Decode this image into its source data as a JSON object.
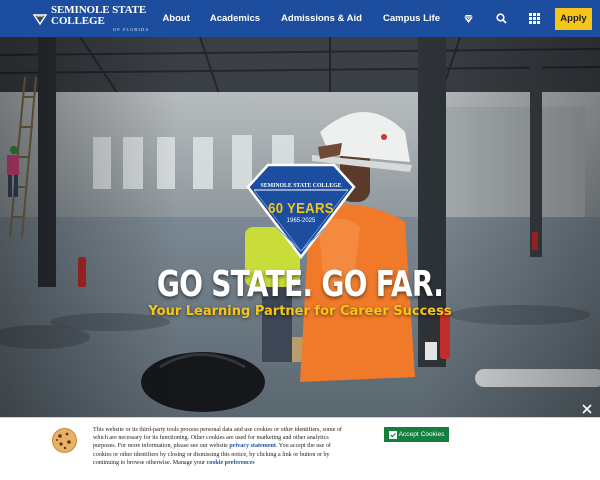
{
  "header": {
    "logo_name": "SEMINOLE STATE COLLEGE",
    "logo_sub": "OF FLORIDA",
    "nav": [
      "About",
      "Academics",
      "Admissions & Aid",
      "Campus Life"
    ],
    "icons": [
      "diamond-icon",
      "search-icon",
      "grid-menu-icon"
    ],
    "apply_label": "Apply",
    "colors": {
      "bar": "#1d4d9e",
      "apply": "#f5c518"
    }
  },
  "hero": {
    "badge_name": "SEMINOLE STATE COLLEGE",
    "badge_years": "60 YEARS",
    "badge_range": "1965-2025",
    "headline": "GO STATE. GO FAR.",
    "tagline": "Your Learning Partner for Career Success"
  },
  "cookie": {
    "text_main": "This website or its third-party tools process personal data and use cookies or other identifiers, some of which are necessary for its functioning. Other cookies are used for marketing and other analytics purposes. For more information, please see our website",
    "privacy_link": "privacy statement",
    "text_rest": ". You accept the use of cookies or other identifiers by closing or dismissing this notice, by clicking a link or button or by continuing to browse otherwise. Manage your",
    "prefs_link": "cookie preferences",
    "accept_label": "Accept Cookies",
    "colors": {
      "accept": "#157f3e"
    }
  }
}
